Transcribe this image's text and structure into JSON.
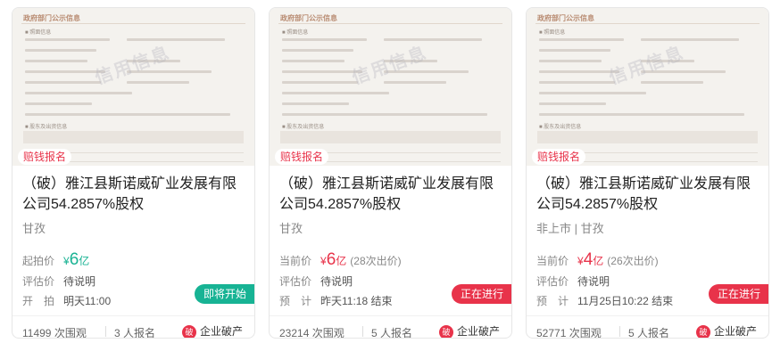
{
  "cards": [
    {
      "thumb": {
        "doc_title": "政府部门公示信息",
        "section1": "■ 照面信息",
        "section2": "■ 股东及出资信息",
        "watermark": "信用信息"
      },
      "badge": "赔钱报名",
      "title": "（破）雅江县斯诺威矿业发展有限公司54.2857%股权",
      "location": "甘孜",
      "price_label": "起拍价",
      "currency": "¥",
      "price_value": "6",
      "price_unit": "亿",
      "bid_count": "",
      "eval_label": "评估价",
      "eval_value": "待说明",
      "time_label": "开　拍",
      "time_value": "明天11:00",
      "status": "即将开始",
      "views": "11499 次围观",
      "signups": "3 人报名",
      "category_icon": "破",
      "category": "企业破产"
    },
    {
      "thumb": {
        "doc_title": "政府部门公示信息",
        "section1": "■ 照面信息",
        "section2": "■ 股东及出资信息",
        "watermark": "信用信息"
      },
      "badge": "赔钱报名",
      "title": "（破）雅江县斯诺威矿业发展有限公司54.2857%股权",
      "location": "甘孜",
      "price_label": "当前价",
      "currency": "¥",
      "price_value": "6",
      "price_unit": "亿",
      "bid_count": "(28次出价)",
      "eval_label": "评估价",
      "eval_value": "待说明",
      "time_label": "预　计",
      "time_value": "昨天11:18 结束",
      "status": "正在进行",
      "views": "23214 次围观",
      "signups": "5 人报名",
      "category_icon": "破",
      "category": "企业破产"
    },
    {
      "thumb": {
        "doc_title": "政府部门公示信息",
        "section1": "■ 照面信息",
        "section2": "■ 股东及出资信息",
        "watermark": "信用信息"
      },
      "badge": "赔钱报名",
      "title": "（破）雅江县斯诺威矿业发展有限公司54.2857%股权",
      "location": "非上市 | 甘孜",
      "price_label": "当前价",
      "currency": "¥",
      "price_value": "4",
      "price_unit": "亿",
      "bid_count": "(26次出价)",
      "eval_label": "评估价",
      "eval_value": "待说明",
      "time_label": "预　计",
      "time_value": "11月25日10:22 结束",
      "status": "正在进行",
      "views": "52771 次围观",
      "signups": "5 人报名",
      "category_icon": "破",
      "category": "企业破产"
    }
  ],
  "colors": {
    "accent_red": "#e8334a",
    "accent_green": "#17b394"
  }
}
